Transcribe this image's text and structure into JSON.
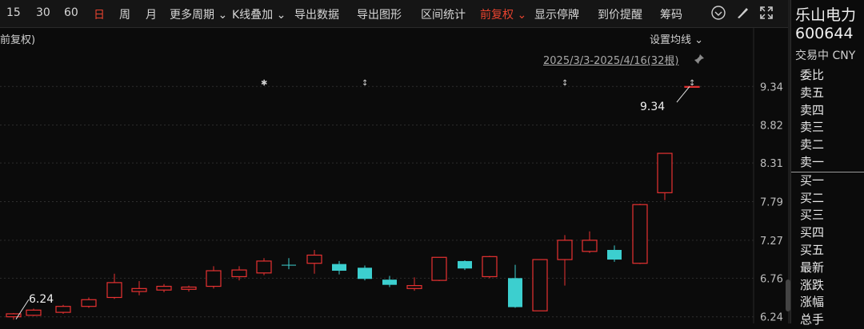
{
  "toolbar": {
    "items": [
      {
        "label": "15",
        "active": false
      },
      {
        "label": "30",
        "active": false
      },
      {
        "label": "60",
        "active": false
      },
      {
        "label": "日",
        "active": true
      },
      {
        "label": "周",
        "active": false
      },
      {
        "label": "月",
        "active": false
      },
      {
        "label": "更多周期 ⌄",
        "active": false
      },
      {
        "label": "K线叠加 ⌄",
        "active": false
      },
      {
        "label": "导出数据",
        "active": false
      },
      {
        "label": "导出图形",
        "active": false
      },
      {
        "label": "区间统计",
        "active": false
      },
      {
        "label": "前复权 ⌄",
        "active": true
      },
      {
        "label": "显示停牌",
        "active": false
      },
      {
        "label": "到价提醒",
        "active": false
      },
      {
        "label": "筹码",
        "active": false
      }
    ]
  },
  "chart": {
    "fq_label": "前复权)",
    "ma_setting": "设置均线 ⌄",
    "range_label": "2025/3/3-2025/4/16(32根)",
    "max_label": "9.34",
    "min_label": "6.24",
    "yticks": [
      "9.34",
      "8.82",
      "8.31",
      "7.79",
      "7.27",
      "6.76",
      "6.24"
    ],
    "colors": {
      "up": "#e83232",
      "down": "#3ccfcf",
      "bg": "#0b0b0b",
      "grid": "#333333"
    }
  },
  "chart_data": {
    "type": "candlestick",
    "ylim": [
      6.14,
      9.44
    ],
    "candles": [
      {
        "o": 6.24,
        "h": 6.29,
        "l": 6.2,
        "c": 6.28
      },
      {
        "o": 6.26,
        "h": 6.35,
        "l": 6.25,
        "c": 6.33
      },
      {
        "o": 6.3,
        "h": 6.4,
        "l": 6.28,
        "c": 6.38
      },
      {
        "o": 6.38,
        "h": 6.5,
        "l": 6.36,
        "c": 6.47
      },
      {
        "o": 6.5,
        "h": 6.82,
        "l": 6.48,
        "c": 6.7
      },
      {
        "o": 6.58,
        "h": 6.72,
        "l": 6.53,
        "c": 6.62
      },
      {
        "o": 6.6,
        "h": 6.68,
        "l": 6.57,
        "c": 6.65
      },
      {
        "o": 6.61,
        "h": 6.66,
        "l": 6.58,
        "c": 6.64
      },
      {
        "o": 6.65,
        "h": 6.92,
        "l": 6.62,
        "c": 6.86
      },
      {
        "o": 6.78,
        "h": 6.92,
        "l": 6.73,
        "c": 6.87
      },
      {
        "o": 6.83,
        "h": 7.03,
        "l": 6.8,
        "c": 6.99
      },
      {
        "o": 6.94,
        "h": 7.03,
        "l": 6.88,
        "c": 6.93
      },
      {
        "o": 6.96,
        "h": 7.14,
        "l": 6.82,
        "c": 7.07
      },
      {
        "o": 6.95,
        "h": 6.99,
        "l": 6.81,
        "c": 6.86
      },
      {
        "o": 6.9,
        "h": 6.93,
        "l": 6.73,
        "c": 6.75
      },
      {
        "o": 6.74,
        "h": 6.79,
        "l": 6.64,
        "c": 6.67
      },
      {
        "o": 6.62,
        "h": 6.77,
        "l": 6.59,
        "c": 6.66
      },
      {
        "o": 6.73,
        "h": 7.04,
        "l": 6.72,
        "c": 7.04
      },
      {
        "o": 6.99,
        "h": 7.0,
        "l": 6.87,
        "c": 6.89
      },
      {
        "o": 6.78,
        "h": 7.06,
        "l": 6.76,
        "c": 7.05
      },
      {
        "o": 6.76,
        "h": 6.94,
        "l": 6.36,
        "c": 6.37
      },
      {
        "o": 6.32,
        "h": 7.01,
        "l": 6.32,
        "c": 7.01
      },
      {
        "o": 7.01,
        "h": 7.34,
        "l": 6.66,
        "c": 7.27
      },
      {
        "o": 7.12,
        "h": 7.39,
        "l": 7.1,
        "c": 7.27
      },
      {
        "o": 7.14,
        "h": 7.2,
        "l": 6.98,
        "c": 7.01
      },
      {
        "o": 6.96,
        "h": 7.76,
        "l": 6.95,
        "c": 7.75
      },
      {
        "o": 7.91,
        "h": 8.44,
        "l": 7.81,
        "c": 8.44
      },
      {
        "o": 9.34,
        "h": 9.34,
        "l": 9.34,
        "c": 9.34
      }
    ]
  },
  "right": {
    "name": "乐山电力",
    "code": "600644",
    "status": "交易中 CNY",
    "rows": [
      "委比",
      "卖五",
      "卖四",
      "卖三",
      "卖二",
      "卖一",
      "买一",
      "买二",
      "买三",
      "买四",
      "买五",
      "最新",
      "涨跌",
      "涨幅",
      "总手"
    ]
  }
}
